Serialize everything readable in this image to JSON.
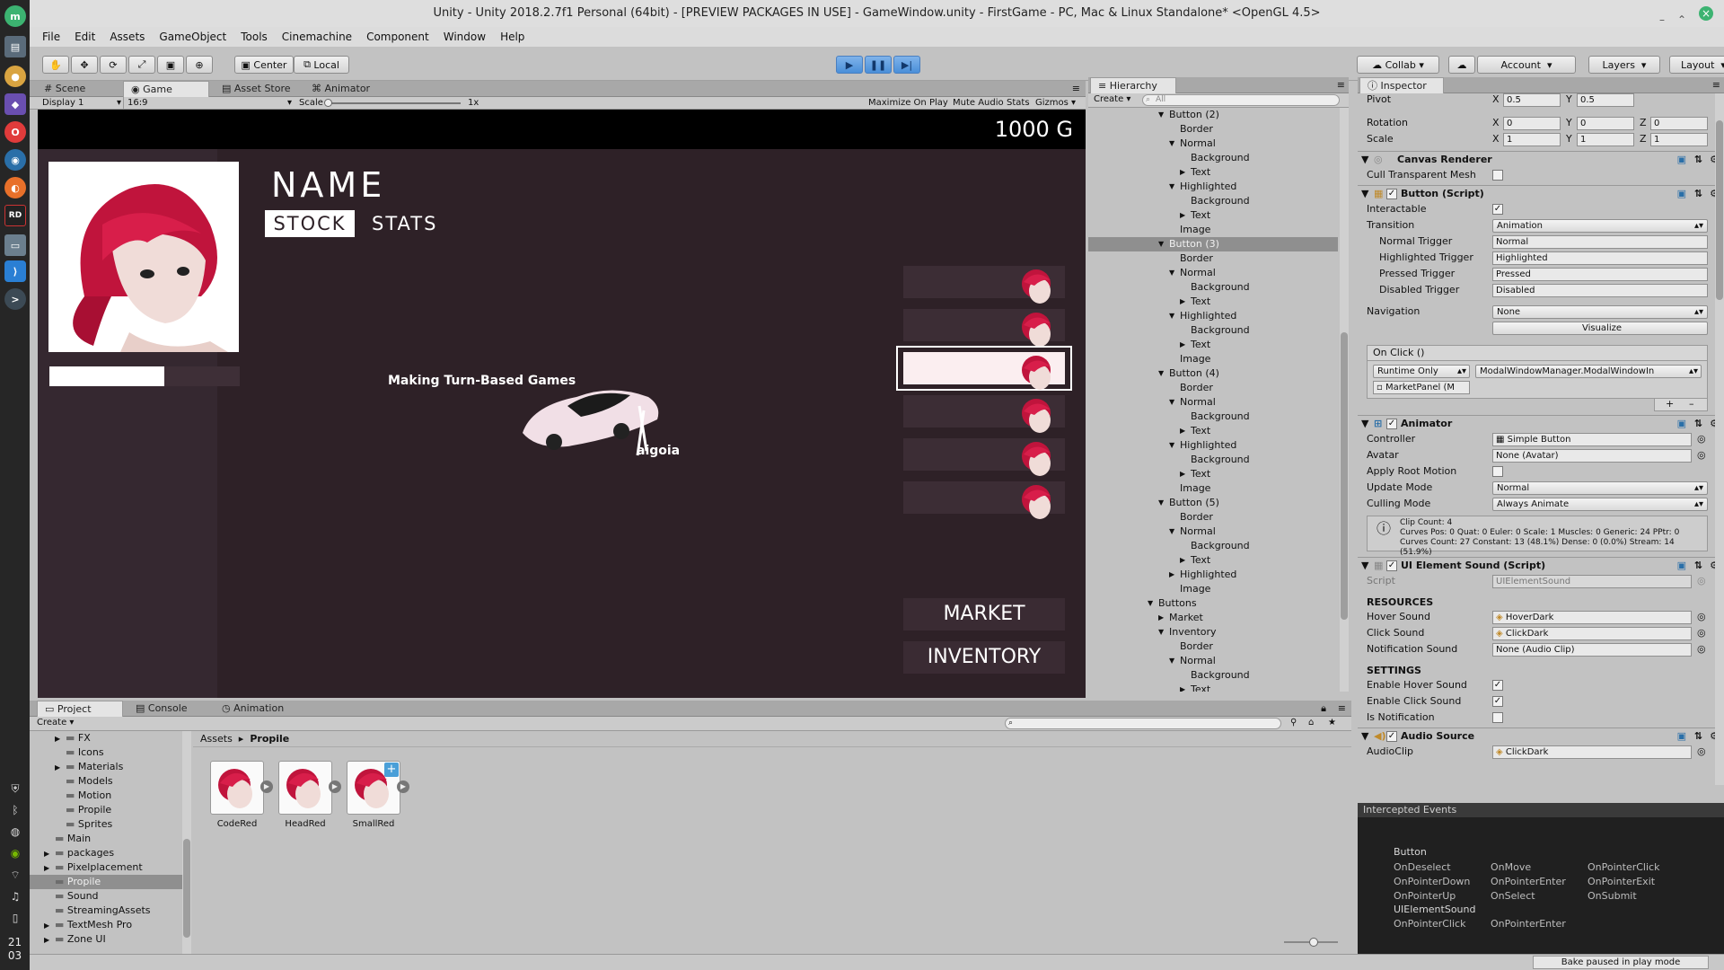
{
  "window": {
    "title": "Unity - Unity 2018.2.7f1 Personal (64bit) - [PREVIEW PACKAGES IN USE] - GameWindow.unity - FirstGame - PC, Mac & Linux Standalone* <OpenGL 4.5>"
  },
  "menu": [
    "File",
    "Edit",
    "Assets",
    "GameObject",
    "Tools",
    "Cinemachine",
    "Component",
    "Window",
    "Help"
  ],
  "toolbar": {
    "center": "Center",
    "local": "Local",
    "collab": "Collab",
    "account": "Account",
    "layers": "Layers",
    "layout": "Layout"
  },
  "scene_tabs": [
    "Scene",
    "Game",
    "Asset Store",
    "Animator"
  ],
  "game_bar": {
    "display": "Display 1",
    "aspect": "16:9",
    "scale_label": "Scale",
    "scale_value": "1x",
    "maximize": "Maximize On Play",
    "mute": "Mute Audio",
    "stats": "Stats",
    "gizmos": "Gizmos"
  },
  "game": {
    "gold": "1000 G",
    "name": "NAME",
    "tab_stock": "STOCK",
    "tab_stats": "STATS",
    "caption": "Making Turn-Based Games",
    "author": "aigoia",
    "market": "MARKET",
    "inventory": "INVENTORY"
  },
  "hierarchy": {
    "tab": "Hierarchy",
    "create": "Create",
    "search_placeholder": "All",
    "rows": [
      {
        "t": "Button (2)",
        "i": 1,
        "a": "▼"
      },
      {
        "t": "Border",
        "i": 2,
        "a": ""
      },
      {
        "t": "Normal",
        "i": 2,
        "a": "▼"
      },
      {
        "t": "Background",
        "i": 3,
        "a": ""
      },
      {
        "t": "Text",
        "i": 3,
        "a": "▶"
      },
      {
        "t": "Highlighted",
        "i": 2,
        "a": "▼"
      },
      {
        "t": "Background",
        "i": 3,
        "a": ""
      },
      {
        "t": "Text",
        "i": 3,
        "a": "▶"
      },
      {
        "t": "Image",
        "i": 2,
        "a": ""
      },
      {
        "t": "Button (3)",
        "i": 1,
        "a": "▼",
        "sel": true
      },
      {
        "t": "Border",
        "i": 2,
        "a": ""
      },
      {
        "t": "Normal",
        "i": 2,
        "a": "▼"
      },
      {
        "t": "Background",
        "i": 3,
        "a": ""
      },
      {
        "t": "Text",
        "i": 3,
        "a": "▶"
      },
      {
        "t": "Highlighted",
        "i": 2,
        "a": "▼"
      },
      {
        "t": "Background",
        "i": 3,
        "a": ""
      },
      {
        "t": "Text",
        "i": 3,
        "a": "▶"
      },
      {
        "t": "Image",
        "i": 2,
        "a": ""
      },
      {
        "t": "Button (4)",
        "i": 1,
        "a": "▼"
      },
      {
        "t": "Border",
        "i": 2,
        "a": ""
      },
      {
        "t": "Normal",
        "i": 2,
        "a": "▼"
      },
      {
        "t": "Background",
        "i": 3,
        "a": ""
      },
      {
        "t": "Text",
        "i": 3,
        "a": "▶"
      },
      {
        "t": "Highlighted",
        "i": 2,
        "a": "▼"
      },
      {
        "t": "Background",
        "i": 3,
        "a": ""
      },
      {
        "t": "Text",
        "i": 3,
        "a": "▶"
      },
      {
        "t": "Image",
        "i": 2,
        "a": ""
      },
      {
        "t": "Button (5)",
        "i": 1,
        "a": "▼"
      },
      {
        "t": "Border",
        "i": 2,
        "a": ""
      },
      {
        "t": "Normal",
        "i": 2,
        "a": "▼"
      },
      {
        "t": "Background",
        "i": 3,
        "a": ""
      },
      {
        "t": "Text",
        "i": 3,
        "a": "▶"
      },
      {
        "t": "Highlighted",
        "i": 2,
        "a": "▶"
      },
      {
        "t": "Image",
        "i": 2,
        "a": ""
      },
      {
        "t": "Buttons",
        "i": 0,
        "a": "▼"
      },
      {
        "t": "Market",
        "i": 1,
        "a": "▶"
      },
      {
        "t": "Inventory",
        "i": 1,
        "a": "▼"
      },
      {
        "t": "Border",
        "i": 2,
        "a": ""
      },
      {
        "t": "Normal",
        "i": 2,
        "a": "▼"
      },
      {
        "t": "Background",
        "i": 3,
        "a": ""
      },
      {
        "t": "Text",
        "i": 3,
        "a": "▶"
      }
    ]
  },
  "inspector": {
    "tab": "Inspector",
    "pivot": {
      "label": "Pivot",
      "x": "0.5",
      "y": "0.5"
    },
    "rotation": {
      "label": "Rotation",
      "x": "0",
      "y": "0",
      "z": "0"
    },
    "scale": {
      "label": "Scale",
      "x": "1",
      "y": "1",
      "z": "1"
    },
    "canvas_renderer": {
      "title": "Canvas Renderer",
      "cull": "Cull Transparent Mesh"
    },
    "button": {
      "title": "Button (Script)",
      "interactable": "Interactable",
      "transition": "Transition",
      "transition_value": "Animation",
      "normal_trigger": "Normal Trigger",
      "normal_value": "Normal",
      "highlighted_trigger": "Highlighted Trigger",
      "highlighted_value": "Highlighted",
      "pressed_trigger": "Pressed Trigger",
      "pressed_value": "Pressed",
      "disabled_trigger": "Disabled Trigger",
      "disabled_value": "Disabled",
      "navigation": "Navigation",
      "navigation_value": "None",
      "visualize": "Visualize",
      "onclick": "On Click ()",
      "runtime": "Runtime Only",
      "function": "ModalWindowManager.ModalWindowIn",
      "target": "MarketPanel (M"
    },
    "animator": {
      "title": "Animator",
      "controller": "Controller",
      "controller_value": "Simple Button",
      "avatar": "Avatar",
      "avatar_value": "None (Avatar)",
      "root_motion": "Apply Root Motion",
      "update_mode": "Update Mode",
      "update_value": "Normal",
      "culling_mode": "Culling Mode",
      "culling_value": "Always Animate",
      "info1": "Clip Count: 4",
      "info2": "Curves Pos: 0 Quat: 0 Euler: 0 Scale: 1 Muscles: 0 Generic: 24 PPtr: 0",
      "info3": "Curves Count: 27 Constant: 13 (48.1%) Dense: 0 (0.0%) Stream: 14 (51.9%)"
    },
    "ui_sound": {
      "title": "UI Element Sound (Script)",
      "script": "Script",
      "script_value": "UIElementSound",
      "resources": "RESOURCES",
      "hover": "Hover Sound",
      "hover_value": "HoverDark",
      "click": "Click Sound",
      "click_value": "ClickDark",
      "notification": "Notification Sound",
      "notification_value": "None (Audio Clip)",
      "settings": "SETTINGS",
      "enable_hover": "Enable Hover Sound",
      "enable_click": "Enable Click Sound",
      "is_notification": "Is Notification"
    },
    "audio": {
      "title": "Audio Source",
      "clip": "AudioClip",
      "clip_value": "ClickDark"
    }
  },
  "events": {
    "header": "Intercepted Events",
    "group1": "Button",
    "col1": [
      "OnDeselect",
      "OnPointerDown",
      "OnPointerUp"
    ],
    "col2": [
      "OnMove",
      "OnPointerEnter",
      "OnSelect"
    ],
    "col3": [
      "OnPointerClick",
      "OnPointerExit",
      "OnSubmit"
    ],
    "group2": "UIElementSound",
    "g2col1": "OnPointerClick",
    "g2col2": "OnPointerEnter"
  },
  "project": {
    "tabs": [
      "Project",
      "Console",
      "Animation"
    ],
    "create": "Create",
    "tree": [
      {
        "t": "FX",
        "i": 2,
        "a": "▶"
      },
      {
        "t": "Icons",
        "i": 2,
        "a": ""
      },
      {
        "t": "Materials",
        "i": 2,
        "a": "▶"
      },
      {
        "t": "Models",
        "i": 2,
        "a": ""
      },
      {
        "t": "Motion",
        "i": 2,
        "a": ""
      },
      {
        "t": "Propile",
        "i": 2,
        "a": ""
      },
      {
        "t": "Sprites",
        "i": 2,
        "a": ""
      },
      {
        "t": "Main",
        "i": 1,
        "a": ""
      },
      {
        "t": "packages",
        "i": 1,
        "a": "▶"
      },
      {
        "t": "Pixelplacement",
        "i": 1,
        "a": "▶"
      },
      {
        "t": "Propile",
        "i": 1,
        "a": "",
        "sel": true
      },
      {
        "t": "Sound",
        "i": 1,
        "a": ""
      },
      {
        "t": "StreamingAssets",
        "i": 1,
        "a": ""
      },
      {
        "t": "TextMesh Pro",
        "i": 1,
        "a": "▶"
      },
      {
        "t": "Zone UI",
        "i": 1,
        "a": "▶"
      }
    ],
    "breadcrumb_root": "Assets",
    "breadcrumb_leaf": "Propile",
    "assets": [
      "CodeRed",
      "HeadRed",
      "SmallRed"
    ]
  },
  "status": {
    "bake": "Bake paused in play mode"
  },
  "clock": {
    "hour": "21",
    "minute": "03"
  }
}
